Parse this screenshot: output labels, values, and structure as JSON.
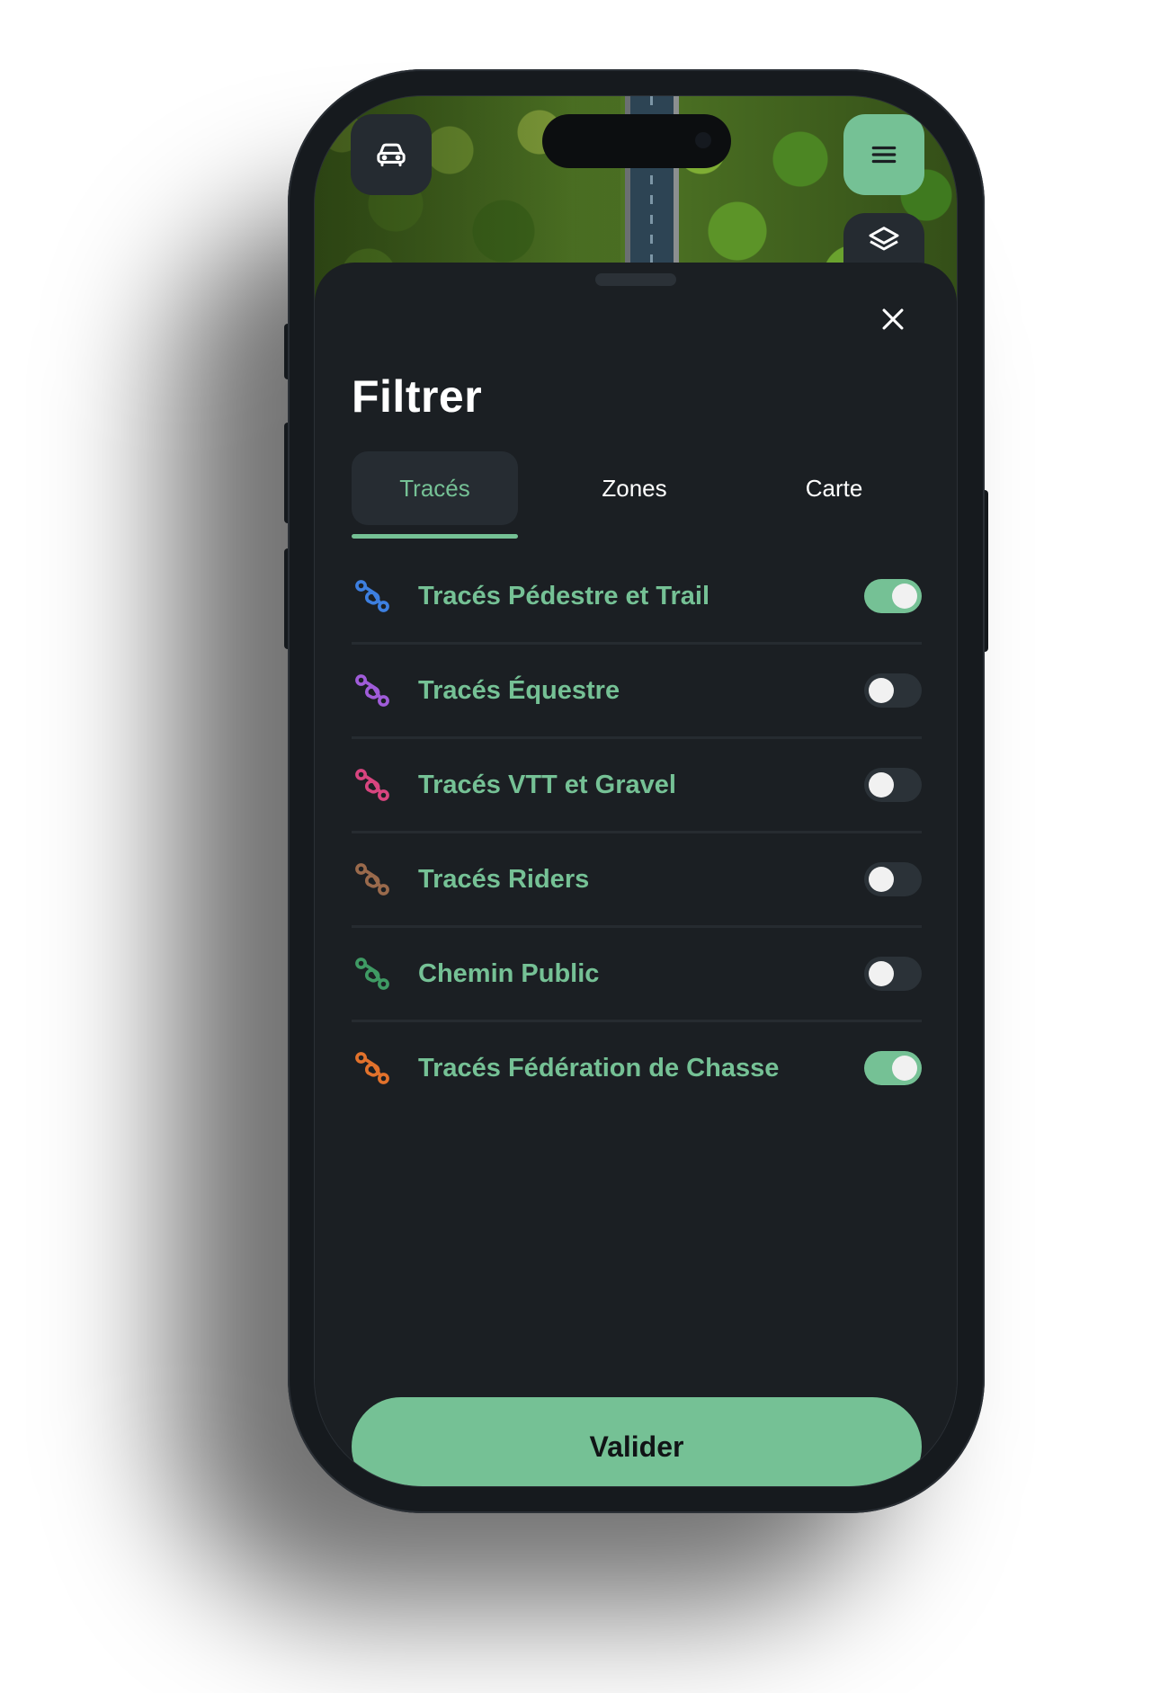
{
  "sheet": {
    "title": "Filtrer"
  },
  "tabs": [
    {
      "label": "Tracés",
      "active": true
    },
    {
      "label": "Zones",
      "active": false
    },
    {
      "label": "Carte",
      "active": false
    }
  ],
  "filters": [
    {
      "label": "Tracés Pédestre et Trail",
      "icon": "route-icon",
      "icon_color": "#3d7fe0",
      "enabled": true
    },
    {
      "label": "Tracés Équestre",
      "icon": "route-icon",
      "icon_color": "#a05cd9",
      "enabled": false
    },
    {
      "label": "Tracés VTT et Gravel",
      "icon": "route-icon",
      "icon_color": "#d8457f",
      "enabled": false
    },
    {
      "label": "Tracés Riders",
      "icon": "route-icon",
      "icon_color": "#9a6a4c",
      "enabled": false
    },
    {
      "label": "Chemin Public",
      "icon": "route-icon",
      "icon_color": "#3f9a64",
      "enabled": false
    },
    {
      "label": "Tracés Fédération de Chasse",
      "icon": "route-icon",
      "icon_color": "#e2722c",
      "enabled": true
    }
  ],
  "actions": {
    "validate_label": "Valider"
  },
  "colors": {
    "accent": "#75c195",
    "background": "#1b1f23"
  }
}
